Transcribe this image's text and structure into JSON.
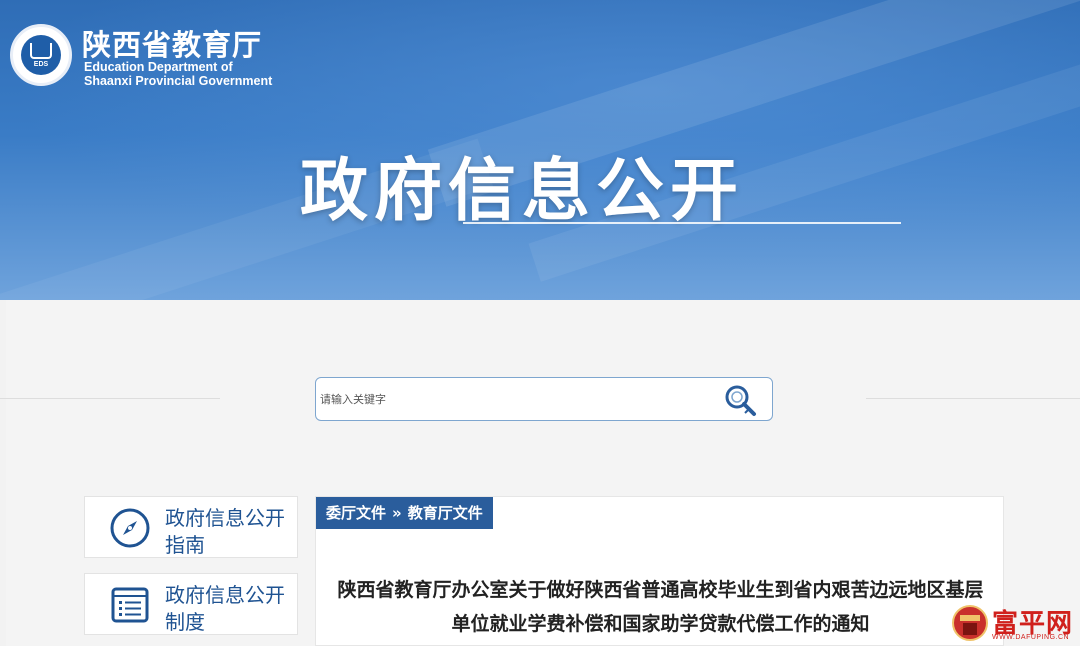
{
  "header": {
    "org_name_cn": "陕西省教育厅",
    "org_name_en_line1": "Education Department of",
    "org_name_en_line2": "Shaanxi Provincial Government",
    "logo_text": "EDS",
    "hero_title": "政府信息公开"
  },
  "search": {
    "placeholder": "请输入关键字",
    "value": "",
    "button_icon": "search-icon"
  },
  "sidebar": {
    "items": [
      {
        "label": "政府信息公开指南",
        "icon": "compass-icon"
      },
      {
        "label": "政府信息公开制度",
        "icon": "list-document-icon"
      }
    ]
  },
  "article": {
    "breadcrumb": [
      "委厅文件",
      "教育厅文件"
    ],
    "breadcrumb_separator": "»",
    "title_line1": "陕西省教育厅办公室关于做好陕西省普通高校毕业生到省内艰苦边远地区基层",
    "title_line2": "单位就业学费补偿和国家助学贷款代偿工作的通知"
  },
  "watermark": {
    "cn": "富平网",
    "en": "WWW.DAFUPING.CN"
  },
  "colors": {
    "accent": "#2a5d9c",
    "nav_text": "#1f5392",
    "banner": "#3a7cc6"
  }
}
